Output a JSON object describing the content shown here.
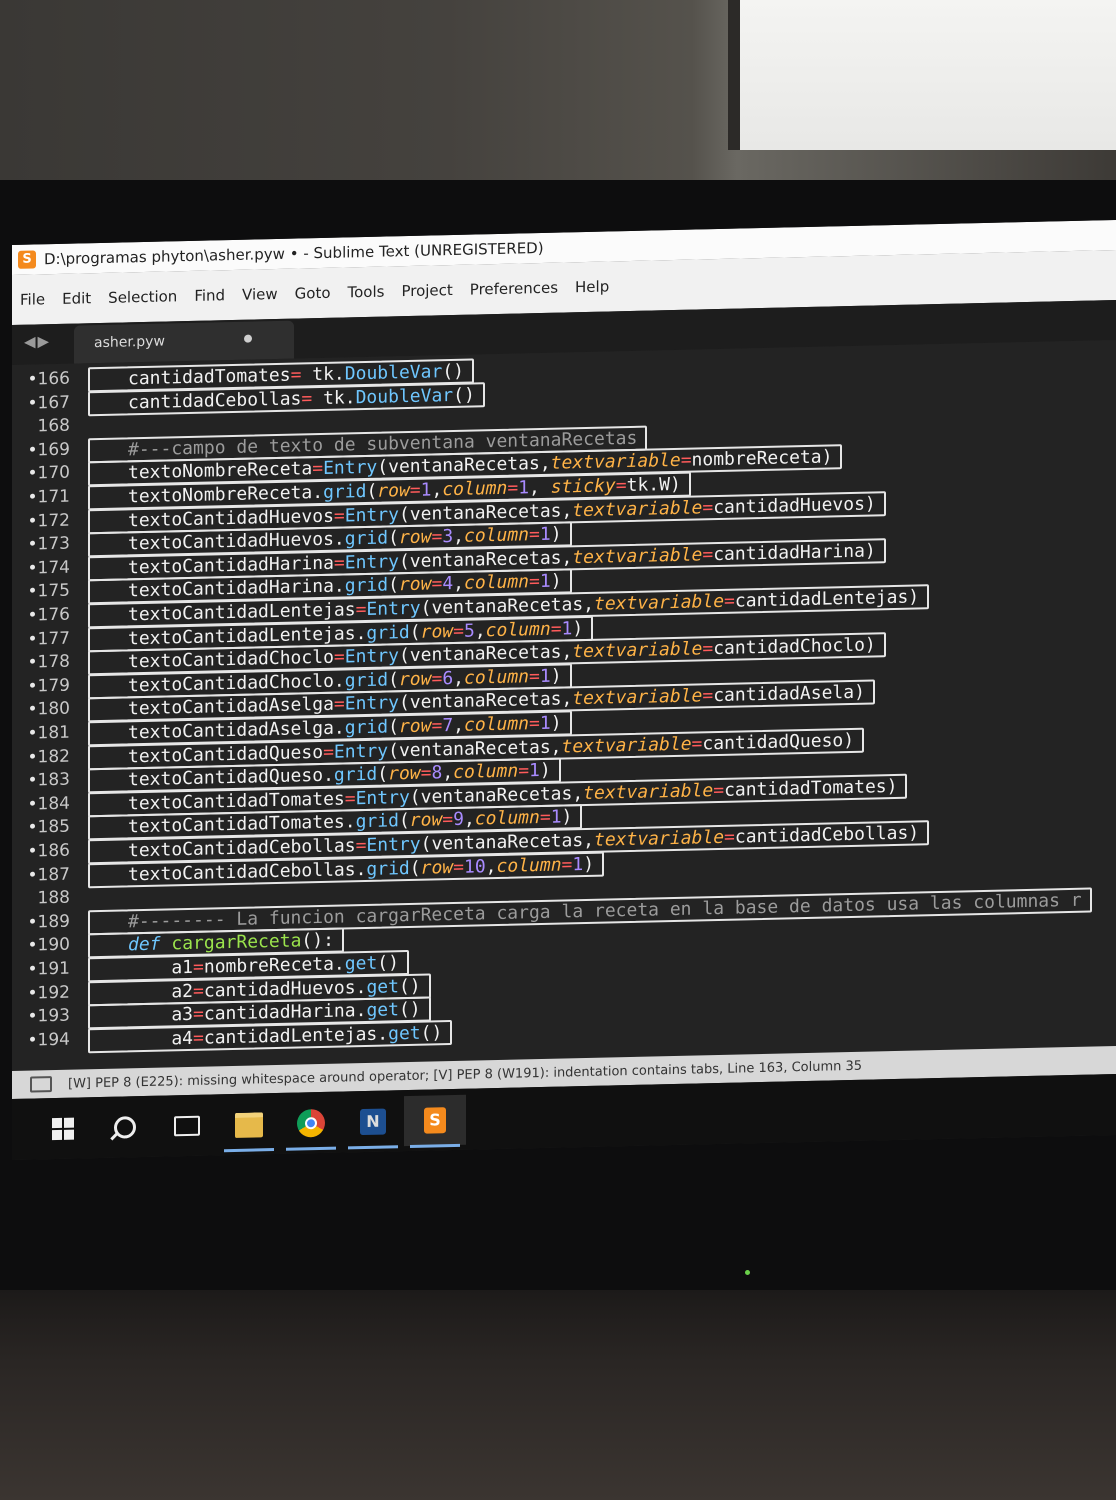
{
  "window": {
    "title": "D:\\programas phyton\\asher.pyw • - Sublime Text (UNREGISTERED)"
  },
  "menu": [
    "File",
    "Edit",
    "Selection",
    "Find",
    "View",
    "Goto",
    "Tools",
    "Project",
    "Preferences",
    "Help"
  ],
  "tabs": [
    {
      "label": "asher.pyw",
      "modified": true
    }
  ],
  "code_lines": [
    {
      "num": "166",
      "mod": true,
      "code": "cantidadTomates= tk.DoubleVar()"
    },
    {
      "num": "167",
      "mod": true,
      "code": "cantidadCebollas= tk.DoubleVar()"
    },
    {
      "num": "168",
      "mod": false,
      "code": ""
    },
    {
      "num": "169",
      "mod": true,
      "code": "#---campo de texto de subventana ventanaRecetas"
    },
    {
      "num": "170",
      "mod": true,
      "code": "textoNombreReceta=Entry(ventanaRecetas,textvariable=nombreReceta)"
    },
    {
      "num": "171",
      "mod": true,
      "code": "textoNombreReceta.grid(row=1,column=1, sticky=tk.W)"
    },
    {
      "num": "172",
      "mod": true,
      "code": "textoCantidadHuevos=Entry(ventanaRecetas,textvariable=cantidadHuevos)"
    },
    {
      "num": "173",
      "mod": true,
      "code": "textoCantidadHuevos.grid(row=3,column=1)"
    },
    {
      "num": "174",
      "mod": true,
      "code": "textoCantidadHarina=Entry(ventanaRecetas,textvariable=cantidadHarina)"
    },
    {
      "num": "175",
      "mod": true,
      "code": "textoCantidadHarina.grid(row=4,column=1)"
    },
    {
      "num": "176",
      "mod": true,
      "code": "textoCantidadLentejas=Entry(ventanaRecetas,textvariable=cantidadLentejas)"
    },
    {
      "num": "177",
      "mod": true,
      "code": "textoCantidadLentejas.grid(row=5,column=1)"
    },
    {
      "num": "178",
      "mod": true,
      "code": "textoCantidadChoclo=Entry(ventanaRecetas,textvariable=cantidadChoclo)"
    },
    {
      "num": "179",
      "mod": true,
      "code": "textoCantidadChoclo.grid(row=6,column=1)"
    },
    {
      "num": "180",
      "mod": true,
      "code": "textoCantidadAselga=Entry(ventanaRecetas,textvariable=cantidadAsela)"
    },
    {
      "num": "181",
      "mod": true,
      "code": "textoCantidadAselga.grid(row=7,column=1)"
    },
    {
      "num": "182",
      "mod": true,
      "code": "textoCantidadQueso=Entry(ventanaRecetas,textvariable=cantidadQueso)"
    },
    {
      "num": "183",
      "mod": true,
      "code": "textoCantidadQueso.grid(row=8,column=1)"
    },
    {
      "num": "184",
      "mod": true,
      "code": "textoCantidadTomates=Entry(ventanaRecetas,textvariable=cantidadTomates)"
    },
    {
      "num": "185",
      "mod": true,
      "code": "textoCantidadTomates.grid(row=9,column=1)"
    },
    {
      "num": "186",
      "mod": true,
      "code": "textoCantidadCebollas=Entry(ventanaRecetas,textvariable=cantidadCebollas)"
    },
    {
      "num": "187",
      "mod": true,
      "code": "textoCantidadCebollas.grid(row=10,column=1)"
    },
    {
      "num": "188",
      "mod": false,
      "code": ""
    },
    {
      "num": "189",
      "mod": true,
      "code": "#-------- La funcion cargarReceta carga la receta en la base de datos usa las columnas r"
    },
    {
      "num": "190",
      "mod": true,
      "code": "def cargarReceta():"
    },
    {
      "num": "191",
      "mod": true,
      "code": "    a1=nombreReceta.get()"
    },
    {
      "num": "192",
      "mod": true,
      "code": "    a2=cantidadHuevos.get()"
    },
    {
      "num": "193",
      "mod": true,
      "code": "    a3=cantidadHarina.get()"
    },
    {
      "num": "194",
      "mod": true,
      "code": "    a4=cantidadLentejas.get()"
    }
  ],
  "statusbar": {
    "text": "[W] PEP 8 (E225): missing whitespace around operator; [V] PEP 8 (W191): indentation contains tabs, Line 163, Column 35"
  },
  "taskbar": {
    "items": [
      "start-icon",
      "search-icon",
      "task-view-icon",
      "file-explorer-icon",
      "chrome-icon",
      "python-idle-icon",
      "sublime-text-icon"
    ]
  },
  "colors": {
    "editor_bg": "#232323",
    "operator": "#ff5b5b",
    "function": "#6fc7ff",
    "keyword_arg": "#ffb347",
    "number": "#a98bff",
    "comment": "#9c9c9c"
  }
}
